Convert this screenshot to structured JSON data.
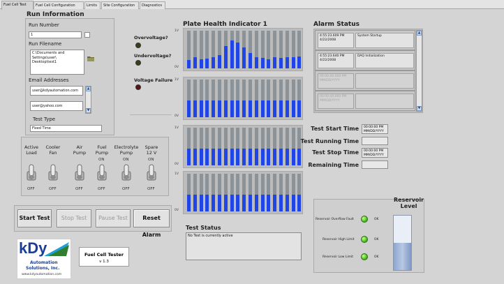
{
  "tabs": [
    {
      "label": "Fuel Cell Test",
      "active": true
    },
    {
      "label": "Fuel Cell Configuration"
    },
    {
      "label": "Limits"
    },
    {
      "label": "Site Configuration"
    },
    {
      "label": "Diagnostics"
    }
  ],
  "run_info": {
    "title": "Run Information",
    "run_number_label": "Run Number",
    "run_number_value": "1",
    "run_filename_label": "Run Filename",
    "run_filename_value": "C:\\Documents and Settings\\user\\\nDesktop\\test1",
    "email_label": "Email Addresses",
    "emails": [
      "user@kdyautomation.com",
      "user@yahoo.com"
    ],
    "test_type_label": "Test Type",
    "test_type_value": "Fixed Time"
  },
  "status_lights": [
    {
      "label": "Overvoltage?",
      "color": "#3d3d16"
    },
    {
      "label": "Undervoltage?",
      "color": "#3d3d16"
    },
    {
      "label": "Voltage Failure",
      "color": "#5a1414"
    }
  ],
  "switches": [
    {
      "label": "Active\nLoad",
      "on": "",
      "off": "OFF",
      "state": "off"
    },
    {
      "label": "Cooler\nFan",
      "on": "",
      "off": "OFF",
      "state": "off"
    },
    {
      "label": "Air\nPump",
      "on": "",
      "off": "OFF",
      "state": "off"
    },
    {
      "label": "Fuel\nPump",
      "on": "ON",
      "off": "OFF",
      "state": "off"
    },
    {
      "label": "Electrolyte\nPump",
      "on": "ON",
      "off": "OFF",
      "state": "off"
    },
    {
      "label": "Spare\n12 V",
      "on": "ON",
      "off": "OFF",
      "state": "off"
    }
  ],
  "buttons": {
    "start": "Start Test",
    "stop": "Stop Test",
    "pause": "Pause Test",
    "reset": "Reset Alarm"
  },
  "logo": {
    "brand": "kDy",
    "line1": "Automation",
    "line2": "Solutions, Inc.",
    "url": "www.kdyautomation.com"
  },
  "app": {
    "name": "Fuel Cell Tester",
    "version": "v 1.3"
  },
  "plate": {
    "title": "Plate Health Indicator 1",
    "axis_top": "1V",
    "axis_bottom": "0V",
    "rows": [
      [
        0.22,
        0.3,
        0.24,
        0.26,
        0.3,
        0.35,
        0.6,
        0.75,
        0.68,
        0.55,
        0.4,
        0.3,
        0.28,
        0.25,
        0.3,
        0.27,
        0.29,
        0.3,
        0.31
      ],
      [
        0.45,
        0.45,
        0.45,
        0.45,
        0.45,
        0.45,
        0.45,
        0.45,
        0.45,
        0.45,
        0.45,
        0.45,
        0.45,
        0.45,
        0.45,
        0.45,
        0.45,
        0.45,
        0.45
      ],
      [
        0.45,
        0.45,
        0.45,
        0.45,
        0.45,
        0.45,
        0.45,
        0.45,
        0.45,
        0.45,
        0.45,
        0.45,
        0.45,
        0.45,
        0.45,
        0.45,
        0.45,
        0.45,
        0.45
      ],
      [
        0.45,
        0.45,
        0.45,
        0.45,
        0.45,
        0.45,
        0.45,
        0.45,
        0.45,
        0.45,
        0.45,
        0.45,
        0.45,
        0.45,
        0.45,
        0.45,
        0.45,
        0.45,
        0.45
      ]
    ]
  },
  "test_status": {
    "label": "Test Status",
    "value": "No Test is currently active"
  },
  "alarm": {
    "title": "Alarm Status",
    "entries": [
      {
        "time": "4:55:23.609 PM\n4/22/2008",
        "message": "System Startup",
        "empty": false
      },
      {
        "time": "4:55:23.640 PM\n4/22/2008",
        "message": "DAQ Initialization",
        "empty": false
      },
      {
        "time": "00:00:00.000 PM\nMM/DD/YYYY",
        "message": "",
        "empty": true
      },
      {
        "time": "00:00:00.000 PM\nMM/DD/YYYY",
        "message": "",
        "empty": true
      }
    ]
  },
  "times": [
    {
      "label": "Test Start Time",
      "value": "00:00:00 PM\nMM/DD/YYYY"
    },
    {
      "label": "Test Running Time",
      "value": ""
    },
    {
      "label": "Test Stop Time",
      "value": "00:00:00 PM\nMM/DD/YYYY"
    },
    {
      "label": "Remaining Time",
      "value": ""
    }
  ],
  "reservoir": {
    "title": "Reservoir\nLevel",
    "level": 0.5,
    "indicators": [
      {
        "label": "Reservoir Overflow Fault",
        "status": "OK"
      },
      {
        "label": "Reservoir High Limit",
        "status": "OK"
      },
      {
        "label": "Reservoir Low Limit",
        "status": "OK"
      }
    ]
  }
}
